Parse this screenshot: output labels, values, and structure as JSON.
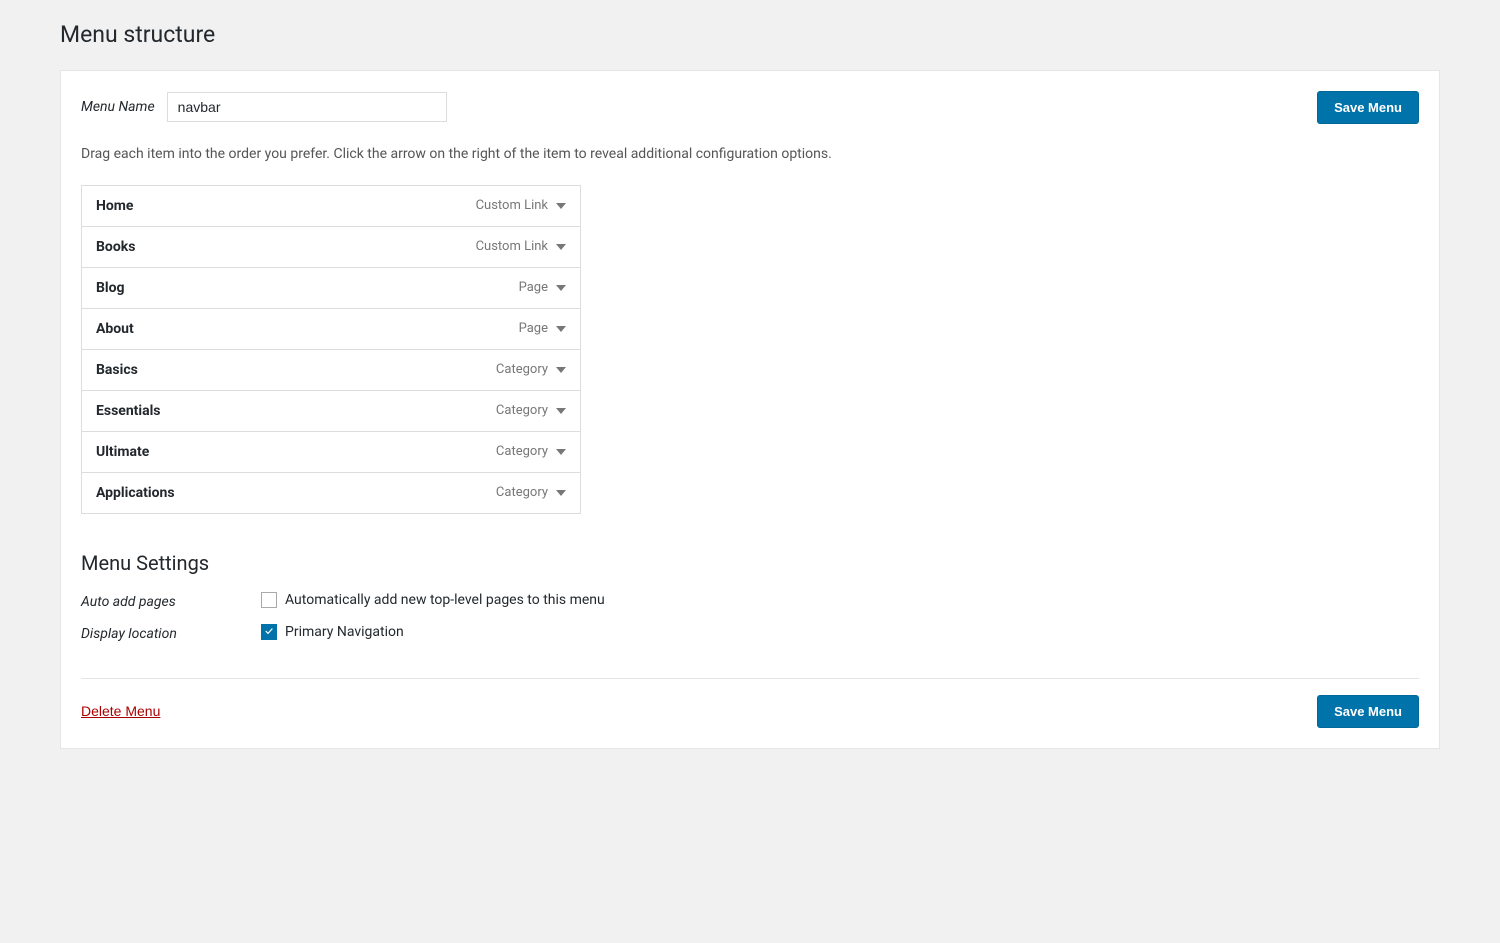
{
  "page": {
    "title": "Menu structure"
  },
  "menu_name_label": "Menu Name",
  "menu_name_value": "navbar",
  "save_menu_label": "Save Menu",
  "drag_instruction": "Drag each item into the order you prefer. Click the arrow on the right of the item to reveal additional configuration options.",
  "menu_items": [
    {
      "id": "home",
      "name": "Home",
      "type": "Custom Link"
    },
    {
      "id": "books",
      "name": "Books",
      "type": "Custom Link"
    },
    {
      "id": "blog",
      "name": "Blog",
      "type": "Page"
    },
    {
      "id": "about",
      "name": "About",
      "type": "Page"
    },
    {
      "id": "basics",
      "name": "Basics",
      "type": "Category"
    },
    {
      "id": "essentials",
      "name": "Essentials",
      "type": "Category"
    },
    {
      "id": "ultimate",
      "name": "Ultimate",
      "type": "Category"
    },
    {
      "id": "applications",
      "name": "Applications",
      "type": "Category"
    }
  ],
  "menu_settings": {
    "title": "Menu Settings",
    "auto_add_label": "Auto add pages",
    "auto_add_text": "Automatically add new top-level pages to this menu",
    "auto_add_checked": false,
    "display_location_label": "Display location",
    "display_location_text": "Primary Navigation",
    "display_location_checked": true
  },
  "delete_menu_label": "Delete Menu"
}
